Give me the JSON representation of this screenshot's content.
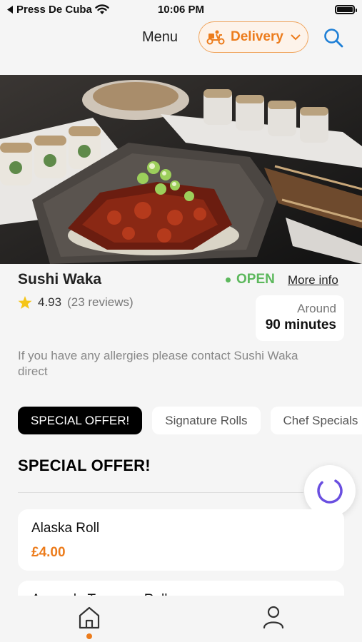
{
  "status_bar": {
    "back_app": "Press De Cuba",
    "time": "10:06 PM"
  },
  "header": {
    "menu_title": "Menu",
    "delivery_label": "Delivery",
    "accent_color": "#ec7c1c"
  },
  "restaurant": {
    "name": "Sushi Waka",
    "rating": "4.93",
    "reviews": "(23 reviews)",
    "status": "OPEN",
    "more_info": "More info",
    "eta_label": "Around",
    "eta_value": "90 minutes",
    "allergy_note": "If you have any allergies please contact Sushi Waka direct"
  },
  "categories": [
    {
      "label": "SPECIAL OFFER!",
      "active": true
    },
    {
      "label": "Signature Rolls",
      "active": false
    },
    {
      "label": "Chef Specials",
      "active": false
    }
  ],
  "section": {
    "title": "SPECIAL OFFER!"
  },
  "items": [
    {
      "name": "Alaska Roll",
      "price": "£4.00"
    },
    {
      "name": "Avocado Tempura Roll",
      "price": ""
    }
  ],
  "tab_bar": {
    "tabs": [
      "home-icon",
      "profile-icon"
    ],
    "active": "home-icon"
  }
}
